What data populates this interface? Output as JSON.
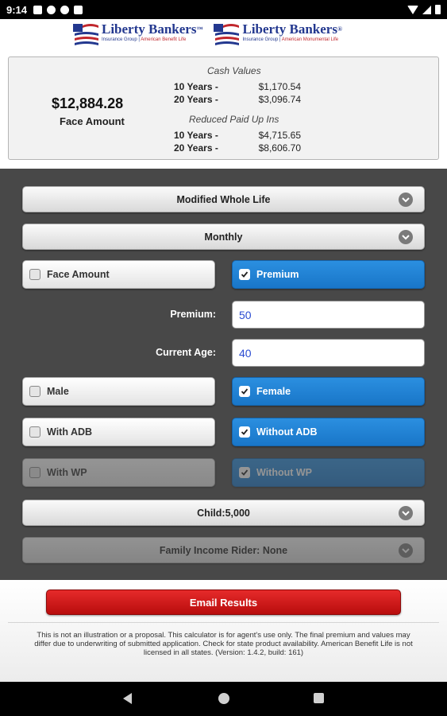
{
  "status_bar": {
    "time": "9:14"
  },
  "header": {
    "logos": [
      {
        "name": "Liberty Bankers",
        "tm": "™",
        "sub_a": "Insurance Group",
        "sub_b": "American Benefit Life"
      },
      {
        "name": "Liberty Bankers",
        "tm": "®",
        "sub_a": "Insurance Group",
        "sub_b": "American Monumental Life"
      }
    ]
  },
  "summary": {
    "face_value": "$12,884.28",
    "face_label": "Face Amount",
    "cash_title": "Cash Values",
    "cash_rows": [
      {
        "years": "10 Years -",
        "value": "$1,170.54"
      },
      {
        "years": "20 Years -",
        "value": "$3,096.74"
      }
    ],
    "rpu_title": "Reduced Paid Up Ins",
    "rpu_rows": [
      {
        "years": "10 Years -",
        "value": "$4,715.65"
      },
      {
        "years": "20 Years -",
        "value": "$8,606.70"
      }
    ]
  },
  "form": {
    "plan": "Modified Whole Life",
    "mode": "Monthly",
    "calc_by": [
      {
        "label": "Face Amount",
        "checked": false
      },
      {
        "label": "Premium",
        "checked": true
      }
    ],
    "premium_label": "Premium:",
    "premium_value": "50",
    "age_label": "Current Age:",
    "age_value": "40",
    "gender": [
      {
        "label": "Male",
        "checked": false
      },
      {
        "label": "Female",
        "checked": true
      }
    ],
    "adb": [
      {
        "label": "With ADB",
        "checked": false
      },
      {
        "label": "Without ADB",
        "checked": true
      }
    ],
    "wp": [
      {
        "label": "With WP",
        "checked": false,
        "disabled": true
      },
      {
        "label": "Without WP",
        "checked": true,
        "disabled": true
      }
    ],
    "child_rider": "Child:5,000",
    "family_rider": "Family Income Rider: None"
  },
  "footer": {
    "email_button": "Email Results",
    "disclaimer": "This is not an illustration or a proposal. This calculator is for agent's use only. The final premium and values may differ due to underwriting of submitted application. Check for state product availability. American Benefit Life is not licensed in all states.  (Version: 1.4.2, build: 161)"
  },
  "colors": {
    "accent_blue": "#1f80d6",
    "email_red": "#d11a1a",
    "panel_gray": "#484848",
    "brand_navy": "#23388f"
  },
  "icons": [
    "chevron-down-icon",
    "checkbox-icon",
    "back-icon",
    "home-icon",
    "recent-apps-icon"
  ]
}
